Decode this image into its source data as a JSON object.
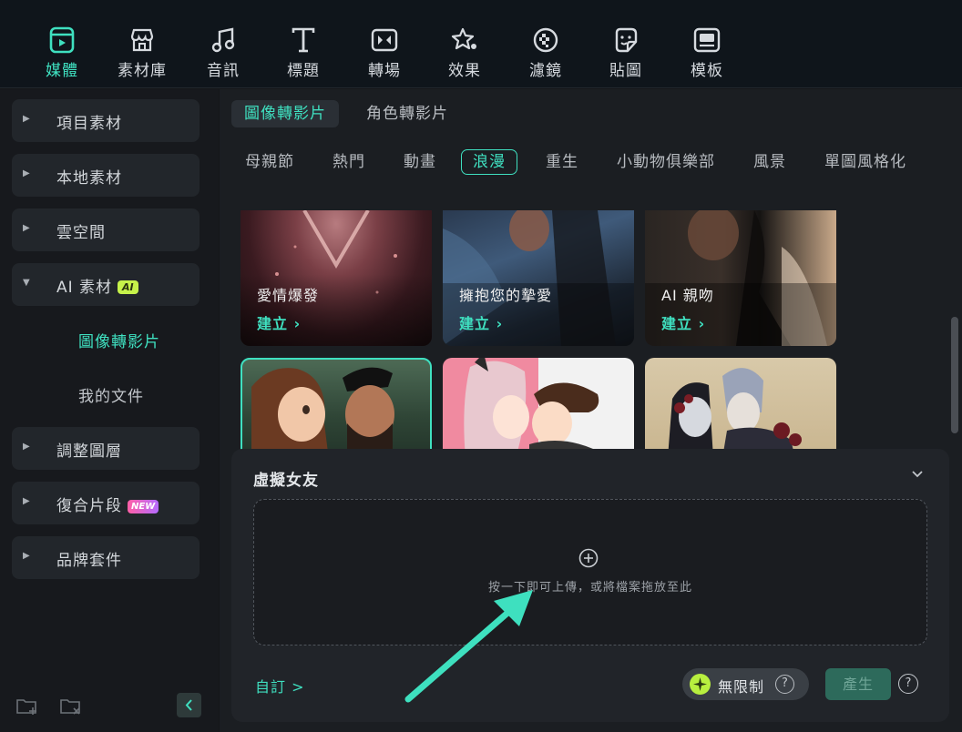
{
  "toolbar": {
    "items": [
      {
        "label": "媒體",
        "icon": "media-icon",
        "active": true
      },
      {
        "label": "素材庫",
        "icon": "store-icon"
      },
      {
        "label": "音訊",
        "icon": "music-note-icon"
      },
      {
        "label": "標題",
        "icon": "text-t-icon"
      },
      {
        "label": "轉場",
        "icon": "transition-icon"
      },
      {
        "label": "效果",
        "icon": "effects-star-icon"
      },
      {
        "label": "濾鏡",
        "icon": "filter-icon"
      },
      {
        "label": "貼圖",
        "icon": "sticker-icon"
      },
      {
        "label": "模板",
        "icon": "template-icon"
      }
    ]
  },
  "sidebar": {
    "items": [
      {
        "label": "項目素材"
      },
      {
        "label": "本地素材"
      },
      {
        "label": "雲空間"
      },
      {
        "label": "AI 素材",
        "badge": "AI",
        "expanded": true
      },
      {
        "label": "調整圖層"
      },
      {
        "label": "復合片段",
        "badge": "NEW"
      },
      {
        "label": "品牌套件"
      }
    ],
    "sub_items": [
      {
        "label": "圖像轉影片",
        "active": true
      },
      {
        "label": "我的文件"
      }
    ]
  },
  "main": {
    "sub_tabs": [
      {
        "label": "圖像轉影片",
        "active": true
      },
      {
        "label": "角色轉影片"
      }
    ],
    "categories": [
      "母親節",
      "熱門",
      "動畫",
      "浪漫",
      "重生",
      "小動物俱樂部",
      "風景",
      "單圖風格化"
    ],
    "active_category": "浪漫",
    "cards": [
      {
        "title": "愛情爆發",
        "action": "建立 ›"
      },
      {
        "title": "擁抱您的摯愛",
        "action": "建立 ›"
      },
      {
        "title": "AI 親吻",
        "action": "建立 ›"
      }
    ]
  },
  "panel": {
    "title": "虛擬女友",
    "upload_text": "按一下即可上傳，或將檔案拖放至此",
    "custom_link": "自訂 >",
    "unlimited_label": "無限制",
    "help": "?",
    "generate_label": "產生"
  },
  "colors": {
    "accent": "#3fe0c0",
    "background": "#141619",
    "panel": "#212429"
  }
}
